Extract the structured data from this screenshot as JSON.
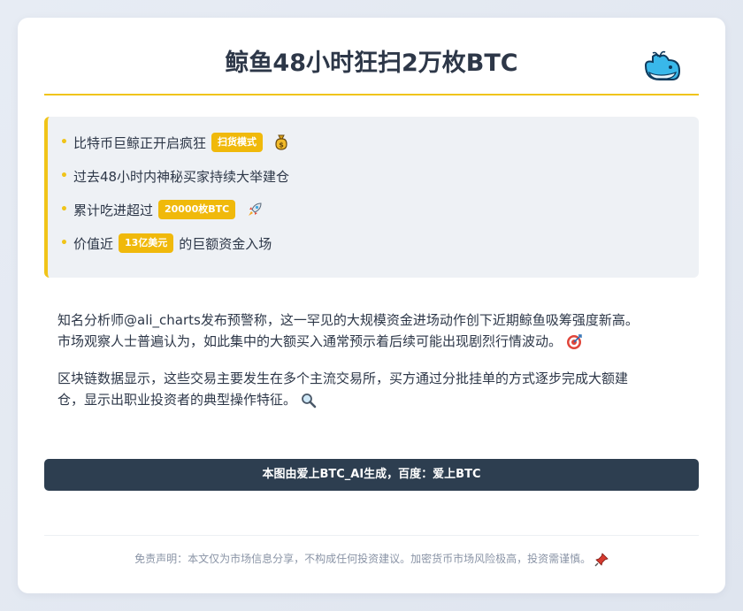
{
  "header": {
    "title": "鲸鱼48小时狂扫2万枚BTC",
    "icon": "whale-icon"
  },
  "points": [
    {
      "text": "比特币巨鲸正开启疯狂",
      "badge": "扫货模式",
      "suffix": "",
      "icon": "money-bag-icon"
    },
    {
      "text": "过去48小时内神秘买家持续大举建仓",
      "badge": "",
      "suffix": "",
      "icon": ""
    },
    {
      "text": "累计吃进超过",
      "badge": "20000枚BTC",
      "suffix": "",
      "icon": "rocket-icon"
    },
    {
      "text": "价值近",
      "badge": "13亿美元",
      "suffix": "的巨额资金入场",
      "icon": ""
    }
  ],
  "paragraphs": [
    {
      "line1": "知名分析师@ali_charts发布预警称，这一罕见的大规模资金进场动作创下近期鲸鱼吸筹强度新高。",
      "line2": "市场观察人士普遍认为，如此集中的大额买入通常预示着后续可能出现剧烈行情波动。",
      "icon": "target-icon"
    },
    {
      "line1": "区块链数据显示，这些交易主要发生在多个主流交易所，买方通过分批挂单的方式逐步完成大额建",
      "line2": "仓，显示出职业投资者的典型操作特征。",
      "icon": "magnifier-icon"
    }
  ],
  "banner": {
    "text": "本图由爱上BTC_AI生成，百度：爱上BTC"
  },
  "footer": {
    "disclaimer": "免责声明：本文仅为市场信息分享，不构成任何投资建议。加密货币市场风险极高，投资需谨慎。",
    "icon": "pin-icon"
  },
  "colors": {
    "accent": "#f0c419",
    "badge": "#f0b90b",
    "banner": "#2d3e50",
    "text": "#2d3748"
  }
}
